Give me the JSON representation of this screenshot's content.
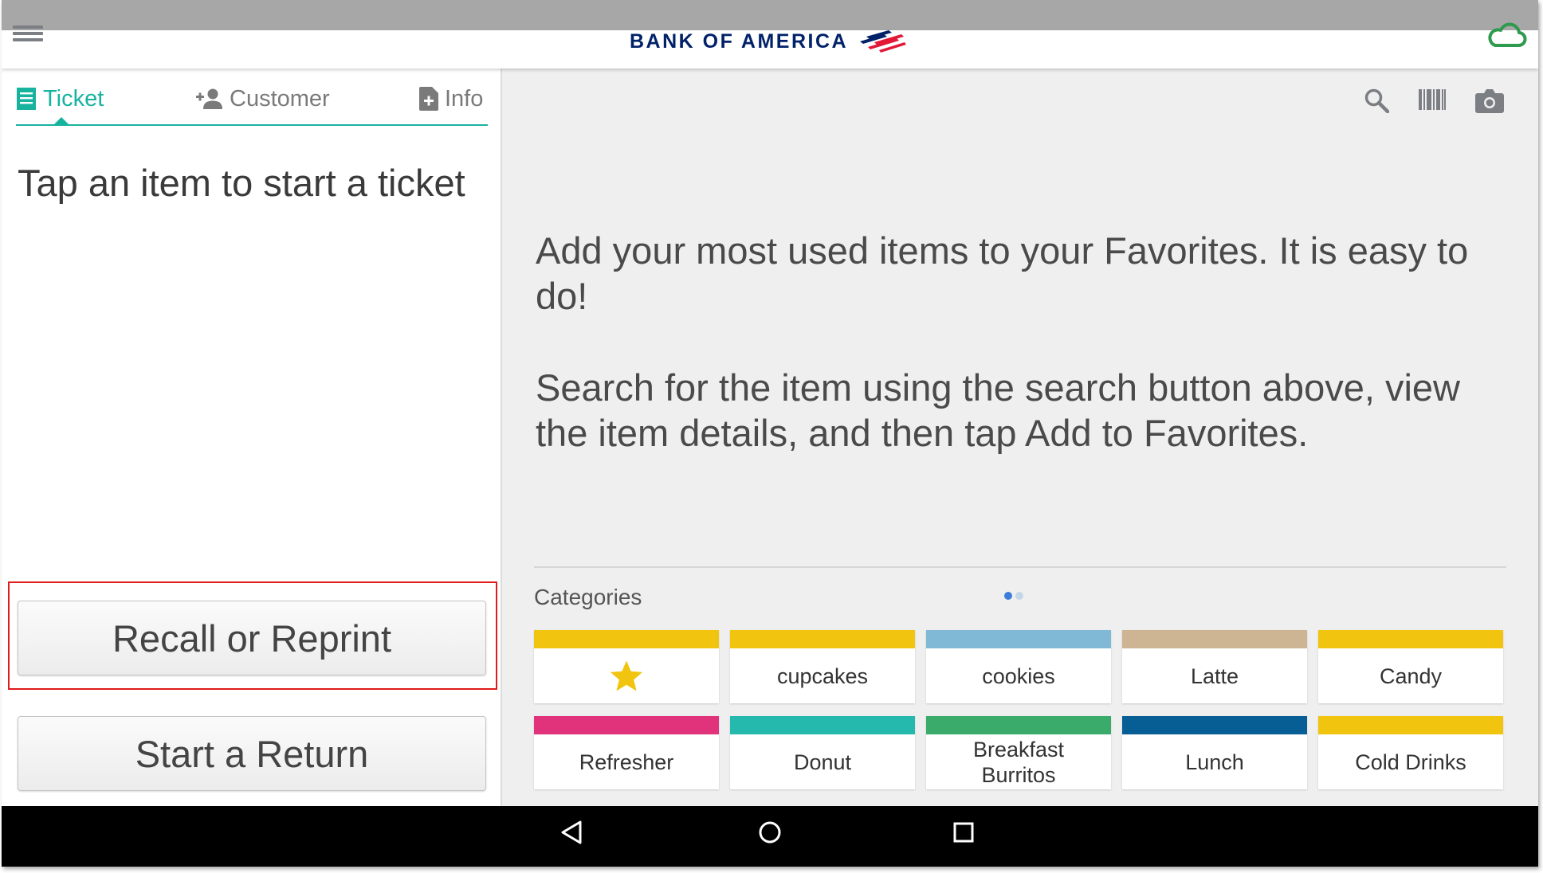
{
  "app_bar": {
    "brand": "BANK OF AMERICA",
    "colors": {
      "brand_navy": "#012169",
      "brand_red": "#e31837",
      "cloud_green": "#2e9a4e"
    }
  },
  "ticket_panel": {
    "tabs": [
      {
        "label": "Ticket",
        "icon": "receipt-icon",
        "active": true
      },
      {
        "label": "Customer",
        "icon": "add-person-icon",
        "active": false
      },
      {
        "label": "Info",
        "icon": "add-document-icon",
        "active": false
      }
    ],
    "accent_color": "#17b39f",
    "empty_hint": "Tap an item to start a ticket",
    "recall_label": "Recall or Reprint",
    "return_label": "Start a Return"
  },
  "favorites_panel": {
    "tools": [
      "search-icon",
      "barcode-icon",
      "camera-icon"
    ],
    "message_1": "Add your most used items to your Favorites. It is easy to do!",
    "message_2": "Search for the item using the search button above, view the item details, and then tap Add to Favorites.",
    "categories_title": "Categories",
    "pagination": {
      "pages": 2,
      "current": 1
    },
    "categories": [
      {
        "label": "",
        "icon": "star-icon",
        "color": "#f1c40f"
      },
      {
        "label": "cupcakes",
        "color": "#f1c40f"
      },
      {
        "label": "cookies",
        "color": "#7fb9d6"
      },
      {
        "label": "Latte",
        "color": "#cdb492"
      },
      {
        "label": "Candy",
        "color": "#f1c40f"
      },
      {
        "label": "Refresher",
        "color": "#e0337c"
      },
      {
        "label": "Donut",
        "color": "#25b8ad"
      },
      {
        "label": "Breakfast Burritos",
        "color": "#3aab6a"
      },
      {
        "label": "Lunch",
        "color": "#075e94"
      },
      {
        "label": "Cold Drinks",
        "color": "#f1c40f"
      }
    ]
  },
  "system_nav": [
    "back-icon",
    "home-icon",
    "recents-icon"
  ]
}
